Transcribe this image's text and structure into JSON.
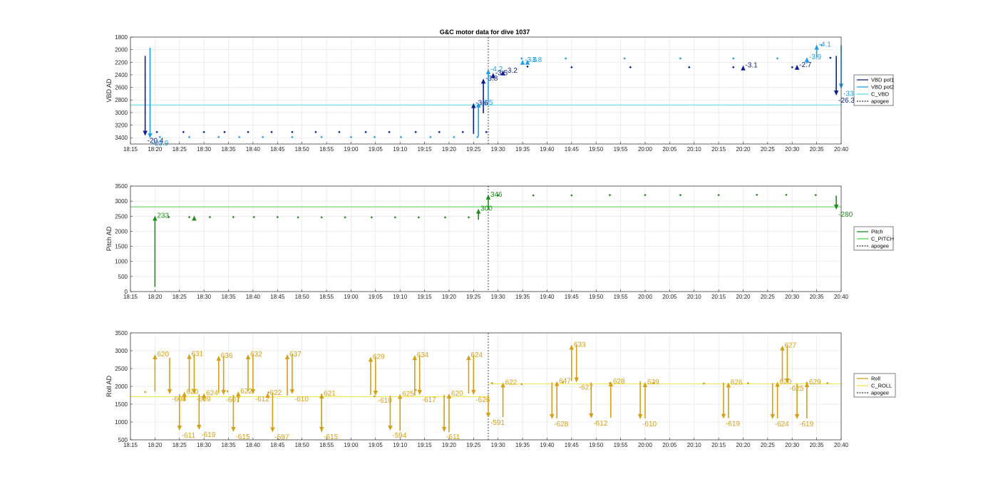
{
  "title": "G&C motor data for dive 1037",
  "chart_data": [
    {
      "type": "scatter",
      "ylabel": "VBD AD",
      "xlim": [
        "18:15",
        "20:40"
      ],
      "ylim": [
        1800,
        3500
      ],
      "reversed_y": true,
      "yticks": [
        1800,
        2000,
        2200,
        2400,
        2600,
        2800,
        3000,
        3200,
        3400
      ],
      "xticks": [
        "18:15",
        "18:20",
        "18:25",
        "18:30",
        "18:35",
        "18:40",
        "18:45",
        "18:50",
        "18:55",
        "19:00",
        "19:05",
        "19:10",
        "19:15",
        "19:20",
        "19:25",
        "19:30",
        "19:35",
        "19:40",
        "19:45",
        "19:50",
        "19:55",
        "20:00",
        "20:05",
        "20:10",
        "20:15",
        "20:20",
        "20:25",
        "20:30",
        "20:35",
        "20:40"
      ],
      "grid": true,
      "legend_position": "right",
      "series": [
        {
          "name": "VBD pot1",
          "color": "#0a1f8f",
          "x": [
            18.34,
            18.43,
            18.5,
            18.57,
            18.65,
            18.73,
            18.8,
            18.88,
            18.96,
            19.05,
            19.13,
            19.22,
            19.3,
            19.38,
            19.46,
            19.6,
            19.75,
            19.95,
            20.15,
            20.3,
            20.5,
            20.63
          ],
          "y": [
            3310,
            3310,
            3310,
            3310,
            3310,
            3310,
            3310,
            3310,
            3310,
            3310,
            3310,
            3310,
            3310,
            3310,
            3310,
            2270,
            2280,
            2280,
            2280,
            2280,
            2280,
            2130
          ]
        },
        {
          "name": "VBD pot2",
          "color": "#1ea0e8",
          "x": [
            18.35,
            18.45,
            18.55,
            18.62,
            18.7,
            18.8,
            18.9,
            19.0,
            19.08,
            19.17,
            19.27,
            19.35,
            19.43,
            19.58,
            19.73,
            19.93,
            20.12,
            20.3,
            20.45,
            20.6
          ],
          "y": [
            3390,
            3390,
            3390,
            3390,
            3390,
            3390,
            3390,
            3390,
            3390,
            3390,
            3390,
            3390,
            3390,
            2140,
            2140,
            2140,
            2140,
            2140,
            2140,
            1930
          ]
        },
        {
          "name": "C_VBD",
          "color": "#5ad8ee",
          "constant": 2880
        },
        {
          "name": "apogee",
          "color": "#333333",
          "x_line": "19:28"
        }
      ],
      "arrows": [
        {
          "series": "VBD pot1",
          "x": "18:18",
          "from": 2100,
          "to": 3370,
          "label": "-20.4"
        },
        {
          "series": "VBD pot2",
          "x": "18:19",
          "from": 1970,
          "to": 3410,
          "label": "-23.9"
        },
        {
          "series": "VBD pot1",
          "x": "19:25",
          "from": 3340,
          "to": 2850,
          "label": "-3.6"
        },
        {
          "series": "VBD pot2",
          "x": "19:26",
          "from": 3380,
          "to": 2840,
          "label": "-4.5"
        },
        {
          "series": "VBD pot1",
          "x": "19:27",
          "from": 3010,
          "to": 2460,
          "label": "-3.8"
        },
        {
          "series": "VBD pot2",
          "x": "19:28",
          "from": 2840,
          "to": 2310,
          "label": "-4.2"
        },
        {
          "series": "VBD pot1",
          "x": "19:29",
          "from": 2460,
          "to": 2370,
          "label": "-3.5"
        },
        {
          "series": "VBD pot1",
          "x": "19:31",
          "from": 2370,
          "to": 2330,
          "label": "-3.2"
        },
        {
          "series": "VBD pot2",
          "x": "19:35",
          "from": 2230,
          "to": 2160,
          "label": "-3.6"
        },
        {
          "series": "VBD pot2",
          "x": "19:36",
          "from": 2180,
          "to": 2160,
          "label": "-3.8"
        },
        {
          "series": "VBD pot1",
          "x": "20:20",
          "from": 2290,
          "to": 2250,
          "label": "-3.1"
        },
        {
          "series": "VBD pot1",
          "x": "20:31",
          "from": 2260,
          "to": 2240,
          "label": "-2.7"
        },
        {
          "series": "VBD pot2",
          "x": "20:33",
          "from": 2220,
          "to": 2120,
          "label": "-3.9"
        },
        {
          "series": "VBD pot2",
          "x": "20:35",
          "from": 2130,
          "to": 1920,
          "label": "-4.1"
        },
        {
          "series": "VBD pot1",
          "x": "20:39",
          "from": 2100,
          "to": 2730,
          "label": "-26.3"
        },
        {
          "series": "VBD pot2",
          "x": "20:40",
          "from": 1930,
          "to": 2620,
          "label": "-33.4"
        }
      ]
    },
    {
      "type": "scatter",
      "ylabel": "Pitch AD",
      "xlim": [
        "18:15",
        "20:40"
      ],
      "ylim": [
        0,
        3500
      ],
      "yticks": [
        0,
        500,
        1000,
        1500,
        2000,
        2500,
        3000,
        3500
      ],
      "xticks": [
        "18:15",
        "18:20",
        "18:25",
        "18:30",
        "18:35",
        "18:40",
        "18:45",
        "18:50",
        "18:55",
        "19:00",
        "19:05",
        "19:10",
        "19:15",
        "19:20",
        "19:25",
        "19:30",
        "19:35",
        "19:40",
        "19:45",
        "19:50",
        "19:55",
        "20:00",
        "20:05",
        "20:10",
        "20:15",
        "20:20",
        "20:25",
        "20:30",
        "20:35",
        "20:40"
      ],
      "grid": true,
      "legend_position": "right",
      "series": [
        {
          "name": "Pitch",
          "color": "#1e8c1e",
          "x": [
            18.38,
            18.45,
            18.52,
            18.6,
            18.67,
            18.75,
            18.82,
            18.9,
            18.98,
            19.07,
            19.15,
            19.23,
            19.32,
            19.4,
            19.5,
            19.62,
            19.75,
            19.88,
            20.0,
            20.12,
            20.25,
            20.38,
            20.48,
            20.58
          ],
          "y": [
            2470,
            2470,
            2470,
            2470,
            2470,
            2470,
            2460,
            2460,
            2460,
            2460,
            2460,
            2460,
            2460,
            2460,
            3190,
            3190,
            3190,
            3200,
            3200,
            3200,
            3200,
            3210,
            3210,
            3200
          ]
        },
        {
          "name": "C_PITCH",
          "color": "#4fd44f",
          "constant": 2810
        },
        {
          "name": "apogee",
          "color": "#333333",
          "x_line": "19:28"
        }
      ],
      "arrows": [
        {
          "x": "18:20",
          "from": 150,
          "to": 2520,
          "label": "233"
        },
        {
          "x": "18:28",
          "from": 2470,
          "to": 2520,
          "label": ""
        },
        {
          "x": "19:26",
          "from": 2380,
          "to": 2750,
          "label": "300"
        },
        {
          "x": "19:28",
          "from": 2750,
          "to": 3220,
          "label": "346"
        },
        {
          "x": "20:39",
          "from": 3180,
          "to": 2720,
          "label": "-280"
        }
      ]
    },
    {
      "type": "scatter",
      "ylabel": "Roll AD",
      "xlim": [
        "18:15",
        "20:40"
      ],
      "ylim": [
        500,
        3500
      ],
      "yticks": [
        500,
        1000,
        1500,
        2000,
        2500,
        3000,
        3500
      ],
      "xticks": [
        "18:15",
        "18:20",
        "18:25",
        "18:30",
        "18:35",
        "18:40",
        "18:45",
        "18:50",
        "18:55",
        "19:00",
        "19:05",
        "19:10",
        "19:15",
        "19:20",
        "19:25",
        "19:30",
        "19:35",
        "19:40",
        "19:45",
        "19:50",
        "19:55",
        "20:00",
        "20:05",
        "20:10",
        "20:15",
        "20:20",
        "20:25",
        "20:30",
        "20:35",
        "20:40"
      ],
      "grid": true,
      "legend_position": "right",
      "series": [
        {
          "name": "Roll",
          "color": "#d4a017",
          "x": [
            18.3,
            18.58,
            18.72,
            18.9,
            19.08,
            19.22,
            19.48,
            19.58,
            19.72,
            19.88,
            20.03,
            20.2,
            20.35,
            20.55,
            20.62
          ],
          "y": [
            1840,
            1860,
            1830,
            1730,
            1720,
            1900,
            2090,
            2060,
            2110,
            2090,
            2100,
            2080,
            2090,
            2100,
            2090
          ]
        },
        {
          "name": "C_ROLL",
          "color": "#f2e64a",
          "constant_segments": [
            {
              "from": "18:15",
              "to": "19:28",
              "y": 1710
            },
            {
              "from": "19:28",
              "to": "20:40",
              "y": 2070
            }
          ]
        },
        {
          "name": "apogee",
          "color": "#333333",
          "x_line": "19:28"
        }
      ],
      "arrows": [
        {
          "x": "18:20",
          "from": 1850,
          "to": 2900,
          "label": "620"
        },
        {
          "x": "18:23",
          "from": 2800,
          "to": 1780,
          "label": "-608"
        },
        {
          "x": "18:25",
          "from": 1780,
          "to": 760,
          "label": "-611"
        },
        {
          "x": "18:26",
          "from": 1600,
          "to": 1850,
          "label": "620"
        },
        {
          "x": "18:27",
          "from": 1850,
          "to": 2910,
          "label": "631"
        },
        {
          "x": "18:28",
          "from": 2900,
          "to": 1780,
          "label": "-609"
        },
        {
          "x": "18:29",
          "from": 1780,
          "to": 780,
          "label": "-619"
        },
        {
          "x": "18:30",
          "from": 1600,
          "to": 1810,
          "label": "624"
        },
        {
          "x": "18:33",
          "from": 1810,
          "to": 2860,
          "label": "636"
        },
        {
          "x": "18:34",
          "from": 2850,
          "to": 1760,
          "label": "-607"
        },
        {
          "x": "18:36",
          "from": 1760,
          "to": 720,
          "label": "-615"
        },
        {
          "x": "18:37",
          "from": 1550,
          "to": 1860,
          "label": "622"
        },
        {
          "x": "18:39",
          "from": 1860,
          "to": 2900,
          "label": "632"
        },
        {
          "x": "18:40",
          "from": 2900,
          "to": 1780,
          "label": "-612"
        },
        {
          "x": "18:43",
          "from": 1780,
          "to": 1820,
          "label": "622"
        },
        {
          "x": "18:44",
          "from": 1820,
          "to": 710,
          "label": "-597"
        },
        {
          "x": "18:47",
          "from": 1740,
          "to": 2900,
          "label": "637"
        },
        {
          "x": "18:48",
          "from": 2900,
          "to": 1780,
          "label": "-610"
        },
        {
          "x": "18:54",
          "from": 720,
          "to": 1800,
          "label": "621"
        },
        {
          "x": "18:54",
          "from": 1800,
          "to": 720,
          "label": "-615"
        },
        {
          "x": "19:04",
          "from": 1760,
          "to": 2830,
          "label": "629"
        },
        {
          "x": "19:05",
          "from": 2830,
          "to": 1740,
          "label": "-610"
        },
        {
          "x": "19:08",
          "from": 1740,
          "to": 760,
          "label": "-594"
        },
        {
          "x": "19:10",
          "from": 760,
          "to": 1790,
          "label": "625"
        },
        {
          "x": "19:13",
          "from": 1740,
          "to": 2880,
          "label": "634"
        },
        {
          "x": "19:14",
          "from": 2870,
          "to": 1760,
          "label": "-617"
        },
        {
          "x": "19:19",
          "from": 1760,
          "to": 720,
          "label": "-611"
        },
        {
          "x": "19:20",
          "from": 720,
          "to": 1800,
          "label": "620"
        },
        {
          "x": "19:24",
          "from": 1800,
          "to": 2880,
          "label": "624"
        },
        {
          "x": "19:25",
          "from": 2880,
          "to": 1760,
          "label": "-626"
        },
        {
          "x": "19:28",
          "from": 1760,
          "to": 1120,
          "label": "-591"
        },
        {
          "x": "19:31",
          "from": 1140,
          "to": 2110,
          "label": "622"
        },
        {
          "x": "19:41",
          "from": 2110,
          "to": 1080,
          "label": "-628"
        },
        {
          "x": "19:42",
          "from": 1100,
          "to": 2150,
          "label": "647"
        },
        {
          "x": "19:45",
          "from": 2150,
          "to": 3170,
          "label": "633"
        },
        {
          "x": "19:46",
          "from": 3160,
          "to": 2110,
          "label": "-627"
        },
        {
          "x": "19:49",
          "from": 2110,
          "to": 1100,
          "label": "-612"
        },
        {
          "x": "19:53",
          "from": 1120,
          "to": 2140,
          "label": "628"
        },
        {
          "x": "19:59",
          "from": 2140,
          "to": 1080,
          "label": "-610"
        },
        {
          "x": "20:00",
          "from": 1100,
          "to": 2120,
          "label": "629"
        },
        {
          "x": "20:16",
          "from": 2100,
          "to": 1090,
          "label": "-619"
        },
        {
          "x": "20:17",
          "from": 1110,
          "to": 2110,
          "label": "626"
        },
        {
          "x": "20:26",
          "from": 2090,
          "to": 1080,
          "label": "-624"
        },
        {
          "x": "20:27",
          "from": 1100,
          "to": 2130,
          "label": "620"
        },
        {
          "x": "20:28",
          "from": 2130,
          "to": 3150,
          "label": "627"
        },
        {
          "x": "20:29",
          "from": 3150,
          "to": 2080,
          "label": "-625"
        },
        {
          "x": "20:31",
          "from": 2080,
          "to": 1080,
          "label": "-619"
        },
        {
          "x": "20:33",
          "from": 1100,
          "to": 2120,
          "label": "629"
        }
      ]
    }
  ]
}
